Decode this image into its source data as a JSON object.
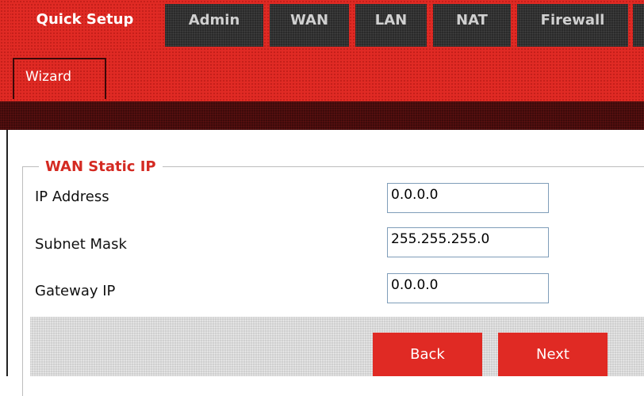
{
  "tabs": [
    {
      "label": "Quick Setup",
      "active": true
    },
    {
      "label": "Admin",
      "active": false
    },
    {
      "label": "WAN",
      "active": false
    },
    {
      "label": "LAN",
      "active": false
    },
    {
      "label": "NAT",
      "active": false
    },
    {
      "label": "Firewall",
      "active": false
    }
  ],
  "subnav": {
    "items": [
      {
        "label": "Wizard"
      }
    ]
  },
  "section": {
    "title": "WAN Static IP",
    "fields": [
      {
        "label": "IP Address",
        "value": "0.0.0.0"
      },
      {
        "label": "Subnet Mask",
        "value": "255.255.255.0"
      },
      {
        "label": "Gateway IP",
        "value": "0.0.0.0"
      }
    ]
  },
  "buttons": {
    "back": "Back",
    "next": "Next"
  },
  "colors": {
    "brand_red": "#e02a24",
    "inactive_tab": "#2a2a2a",
    "dark_band": "#3d0a0a"
  }
}
